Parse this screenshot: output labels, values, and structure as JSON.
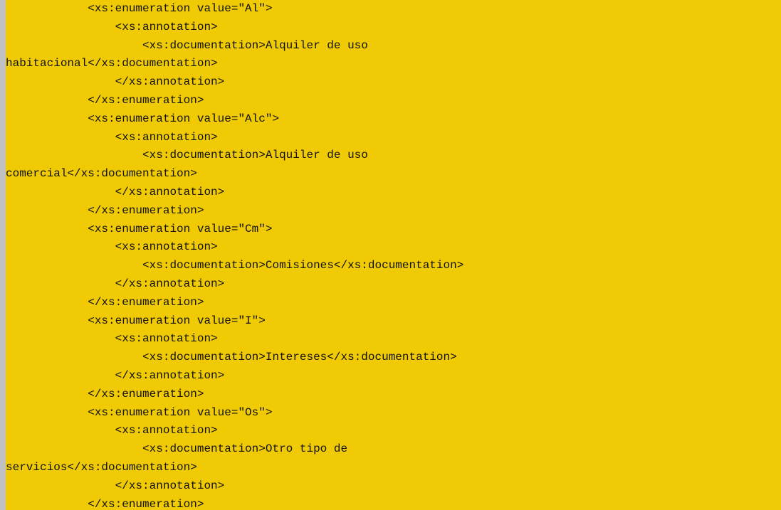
{
  "document": {
    "lines": [
      "            <xs:enumeration value=\"Al\">",
      "                <xs:annotation>",
      "                    <xs:documentation>Alquiler de uso",
      "habitacional</xs:documentation>",
      "                </xs:annotation>",
      "            </xs:enumeration>",
      "            <xs:enumeration value=\"Alc\">",
      "                <xs:annotation>",
      "                    <xs:documentation>Alquiler de uso",
      "comercial</xs:documentation>",
      "                </xs:annotation>",
      "            </xs:enumeration>",
      "            <xs:enumeration value=\"Cm\">",
      "                <xs:annotation>",
      "                    <xs:documentation>Comisiones</xs:documentation>",
      "                </xs:annotation>",
      "            </xs:enumeration>",
      "            <xs:enumeration value=\"I\">",
      "                <xs:annotation>",
      "                    <xs:documentation>Intereses</xs:documentation>",
      "                </xs:annotation>",
      "            </xs:enumeration>",
      "            <xs:enumeration value=\"Os\">",
      "                <xs:annotation>",
      "                    <xs:documentation>Otro tipo de",
      "servicios</xs:documentation>",
      "                </xs:annotation>",
      "            </xs:enumeration>"
    ]
  },
  "colors": {
    "highlight": "#f0cb05",
    "gutter": "#c0c0c0",
    "text": "#111111"
  }
}
